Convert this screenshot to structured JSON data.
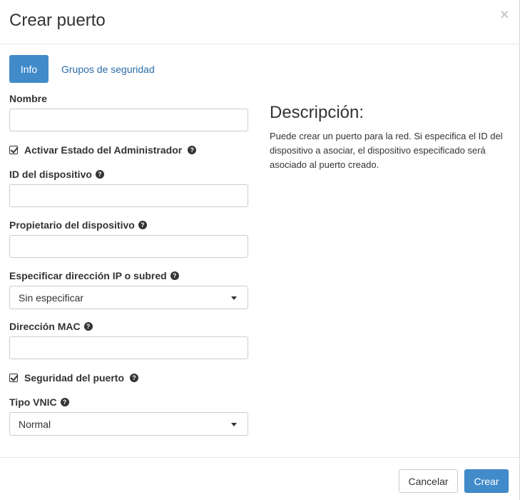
{
  "modal": {
    "title": "Crear puerto",
    "close_symbol": "×"
  },
  "tabs": [
    {
      "label": "Info",
      "active": true
    },
    {
      "label": "Grupos de seguridad",
      "active": false
    }
  ],
  "form": {
    "name_label": "Nombre",
    "name_value": "",
    "admin_state_label": "Activar Estado del Administrador",
    "admin_state_checked": true,
    "device_id_label": "ID del dispositivo",
    "device_id_value": "",
    "device_owner_label": "Propietario del dispositivo",
    "device_owner_value": "",
    "ip_spec_label": "Especificar dirección IP o subred",
    "ip_spec_value": "Sin especificar",
    "mac_label": "Dirección MAC",
    "mac_value": "",
    "port_security_label": "Seguridad del puerto",
    "port_security_checked": true,
    "vnic_label": "Tipo VNIC",
    "vnic_value": "Normal"
  },
  "description": {
    "title": "Descripción:",
    "text": "Puede crear un puerto para la red. Si especifica el ID del dispositivo a asociar, el dispositivo especificado será asociado al puerto creado."
  },
  "footer": {
    "cancel_label": "Cancelar",
    "create_label": "Crear"
  },
  "icons": {
    "help": "question-circle-icon",
    "checkbox": "check-square-icon",
    "close": "close-icon",
    "dropdown": "caret-down-icon"
  },
  "colors": {
    "primary": "#428bca",
    "link": "#2a6ba6",
    "text": "#333333",
    "border": "#cccccc"
  }
}
